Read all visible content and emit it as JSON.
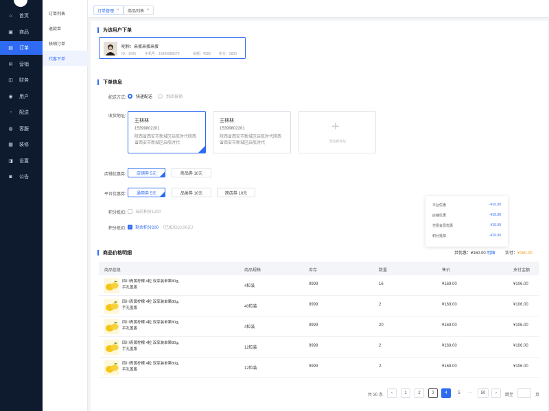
{
  "sidebar": {
    "items": [
      {
        "label": "首页",
        "icon": "home-icon"
      },
      {
        "label": "商品",
        "icon": "box-icon"
      },
      {
        "label": "订单",
        "icon": "order-icon"
      },
      {
        "label": "营销",
        "icon": "marketing-icon"
      },
      {
        "label": "财务",
        "icon": "finance-icon"
      },
      {
        "label": "用户",
        "icon": "user-icon"
      },
      {
        "label": "配送",
        "icon": "delivery-icon"
      },
      {
        "label": "客服",
        "icon": "service-icon"
      },
      {
        "label": "装修",
        "icon": "decor-icon"
      },
      {
        "label": "设置",
        "icon": "settings-icon"
      },
      {
        "label": "公告",
        "icon": "notice-icon"
      }
    ],
    "active_index": 2
  },
  "submenu": {
    "items": [
      "订单列表",
      "退款单",
      "核销订单",
      "代客下单"
    ],
    "active_index": 3
  },
  "tabs": [
    {
      "label": "订单管理",
      "close": "×"
    },
    {
      "label": "商品列表",
      "close": "×"
    }
  ],
  "user_section": {
    "title": "为该用户下单",
    "nickname": "昵称：来蛋来蛋来蛋",
    "id": "ID：1006",
    "phone": "手机号：15899980570",
    "balance": "余额：¥280",
    "points": "积分：5800"
  },
  "order_section": {
    "title": "下单信息",
    "delivery_label": "配送方式：",
    "delivery_options": [
      "快递配送",
      "到店核销"
    ],
    "address_label": "收货地址：",
    "addresses": [
      {
        "name": "王林林",
        "phone": "15399802201",
        "line1": "陕西省西安市新城区启航时代陕西",
        "line2": "省西安市新城区启航时代"
      },
      {
        "name": "王林林",
        "phone": "15399802201",
        "line1": "陕西省西安市新城区启航时代陕西",
        "line2": "省西安市新城区启航时代"
      }
    ],
    "add_address": "添加新地址",
    "add_plus": "+",
    "store_coupon_label": "店铺优惠券：",
    "store_coupons": [
      "店铺券 5元",
      "商品券 10元"
    ],
    "platform_coupon_label": "平台优惠券：",
    "platform_coupons": [
      "通用券 5元",
      "品类券 10元",
      "跨店券 10元"
    ],
    "points_deduct_label": "积分抵扣：",
    "points_option": "当前积分1200",
    "points_pay_label": "积分抵扣：",
    "points_pay_option": "剩余积分200",
    "points_pay_hint": "（已抵扣10.00元）"
  },
  "discount_popover": {
    "rows": [
      {
        "k": "平台优惠",
        "v": "-¥10.00"
      },
      {
        "k": "店铺优惠",
        "v": "-¥10.00"
      },
      {
        "k": "付费会员优惠",
        "v": "-¥10.00"
      },
      {
        "k": "积分抵扣",
        "v": "-¥10.00"
      }
    ]
  },
  "goods_section": {
    "title": "商品价格明细",
    "total_discount_label": "共优惠：",
    "total_discount": "¥160.00",
    "detail_link": "明细",
    "paid_label": "实付：",
    "paid": "¥150.00",
    "columns": [
      "商品信息",
      "商品规格",
      "库存",
      "数量",
      "售价",
      "支付金额"
    ],
    "rows": [
      {
        "name1": "四川青黄柠檬 4粒 双享装单果80g，",
        "name2": "手孔盖版",
        "spec": "4粒装",
        "stock": "9999",
        "qty": "16",
        "price": "¥169.00",
        "pay": "¥106.00"
      },
      {
        "name1": "四川青黄柠檬 4粒 双享装单果80g，",
        "name2": "手孔盖版",
        "spec": "40粒装",
        "stock": "9999",
        "qty": "2",
        "price": "¥169.00",
        "pay": "¥106.00"
      },
      {
        "name1": "四川青黄柠檬 4粒 双享装单果80g，",
        "name2": "手孔盖版",
        "spec": "4粒装",
        "stock": "9999",
        "qty": "20",
        "price": "¥169.00",
        "pay": "¥106.00"
      },
      {
        "name1": "四川青黄柠檬 4粒 双享装单果80g，",
        "name2": "手孔盖版",
        "spec": "12粒装",
        "stock": "9999",
        "qty": "2",
        "price": "¥169.00",
        "pay": "¥106.00"
      },
      {
        "name1": "四川青黄柠檬 4粒 双享装单果80g，",
        "name2": "手孔盖版",
        "spec": "12粒装",
        "stock": "9999",
        "qty": "2",
        "price": "¥169.00",
        "pay": "¥106.00"
      }
    ]
  },
  "pagination": {
    "total": "共 30 条",
    "prev": "‹",
    "pages": [
      "1",
      "2",
      "3",
      "4",
      "5"
    ],
    "ellipsis": "···",
    "last": "50",
    "next": "›",
    "jump_label": "跳至",
    "jump_unit": "页",
    "current": "4"
  },
  "colors": {
    "primary": "#2f6bf2",
    "sidebar": "#0e1a2e",
    "accent": "#f29a1e"
  }
}
